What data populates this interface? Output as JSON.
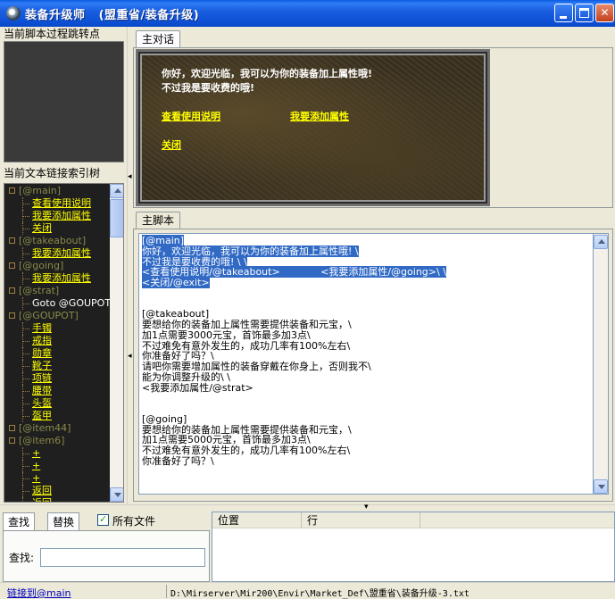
{
  "window": {
    "title": "装备升级师   (盟重省/装备升级)"
  },
  "left_panel": {
    "jump_points_header": "当前脚本过程跳转点",
    "link_index_header": "当前文本链接索引树",
    "tree": [
      {
        "text": "[@main]",
        "kind": "sec"
      },
      {
        "text": "查看使用说明",
        "kind": "link"
      },
      {
        "text": "我要添加属性",
        "kind": "link"
      },
      {
        "text": "关闭",
        "kind": "link"
      },
      {
        "text": "[@takeabout]",
        "kind": "sec"
      },
      {
        "text": "我要添加属性",
        "kind": "link"
      },
      {
        "text": "[@going]",
        "kind": "sec"
      },
      {
        "text": "我要添加属性",
        "kind": "link"
      },
      {
        "text": "[@strat]",
        "kind": "sec"
      },
      {
        "text": "Goto @GOUPOT",
        "kind": "cmd"
      },
      {
        "text": "[@GOUPOT]",
        "kind": "sec"
      },
      {
        "text": "手镯",
        "kind": "link"
      },
      {
        "text": "戒指",
        "kind": "link"
      },
      {
        "text": "勋章",
        "kind": "link"
      },
      {
        "text": "靴子",
        "kind": "link"
      },
      {
        "text": "项链",
        "kind": "link"
      },
      {
        "text": "腰带",
        "kind": "link"
      },
      {
        "text": "头盔",
        "kind": "link"
      },
      {
        "text": "盔甲",
        "kind": "link"
      },
      {
        "text": "[@item44]",
        "kind": "sec"
      },
      {
        "text": "[@item6]",
        "kind": "sec"
      },
      {
        "text": "+",
        "kind": "link"
      },
      {
        "text": "+",
        "kind": "link"
      },
      {
        "text": "+",
        "kind": "link"
      },
      {
        "text": "返回",
        "kind": "link"
      },
      {
        "text": "返回",
        "kind": "link"
      }
    ]
  },
  "dialog_tab": "主对话",
  "dialog_preview": {
    "line1": "你好，欢迎光临，我可以为你的装备加上属性哦!",
    "line2": "不过我是要收费的哦!",
    "link_usage": "查看使用说明",
    "link_add": "我要添加属性",
    "link_close": "关闭"
  },
  "script_tab": "主脚本",
  "script_lines": [
    {
      "text": "[@main]",
      "hl": true
    },
    {
      "text": "你好，欢迎光临，我可以为你的装备加上属性哦! \\",
      "hl": true
    },
    {
      "text": "不过我是要收费的哦! \\ \\",
      "hl": true
    },
    {
      "text": "<查看使用说明/@takeabout>             <我要添加属性/@going>\\ \\",
      "hl": true
    },
    {
      "text": "<关闭/@exit>",
      "hl": true
    },
    {
      "text": "",
      "hl": false
    },
    {
      "text": "",
      "hl": false
    },
    {
      "text": "[@takeabout]",
      "hl": false
    },
    {
      "text": "要想给你的装备加上属性需要提供装备和元宝，\\",
      "hl": false
    },
    {
      "text": "加1点需要3000元宝，首饰最多加3点\\",
      "hl": false
    },
    {
      "text": "不过难免有意外发生的，成功几率有100%左右\\",
      "hl": false
    },
    {
      "text": "你准备好了吗？\\",
      "hl": false
    },
    {
      "text": "请吧你需要增加属性的装备穿戴在你身上，否则我不\\",
      "hl": false
    },
    {
      "text": "能为你调整升级的\\ \\",
      "hl": false
    },
    {
      "text": "<我要添加属性/@strat>",
      "hl": false
    },
    {
      "text": "",
      "hl": false
    },
    {
      "text": "",
      "hl": false
    },
    {
      "text": "[@going]",
      "hl": false
    },
    {
      "text": "要想给你的装备加上属性需要提供装备和元宝，\\",
      "hl": false
    },
    {
      "text": "加1点需要5000元宝，首饰最多加3点\\",
      "hl": false
    },
    {
      "text": "不过难免有意外发生的，成功几率有100%左右\\",
      "hl": false
    },
    {
      "text": "你准备好了吗？\\",
      "hl": false
    }
  ],
  "find_panel": {
    "tab_find": "查找",
    "tab_replace": "替换",
    "all_files_label": "所有文件",
    "all_files_checked": true,
    "find_label": "查找:",
    "find_value": ""
  },
  "results": {
    "col_position": "位置",
    "col_line": "行"
  },
  "status": {
    "link_to": "链接到@main",
    "file_path": "D:\\Mirserver\\Mir200\\Envir\\Market_Def\\盟重省\\装备升级-3.txt"
  },
  "colors": {
    "titlebar": "#0c4fd3",
    "tree_bg": "#1f1f1f",
    "tree_link": "#ffff00",
    "selection": "#316ac5"
  }
}
